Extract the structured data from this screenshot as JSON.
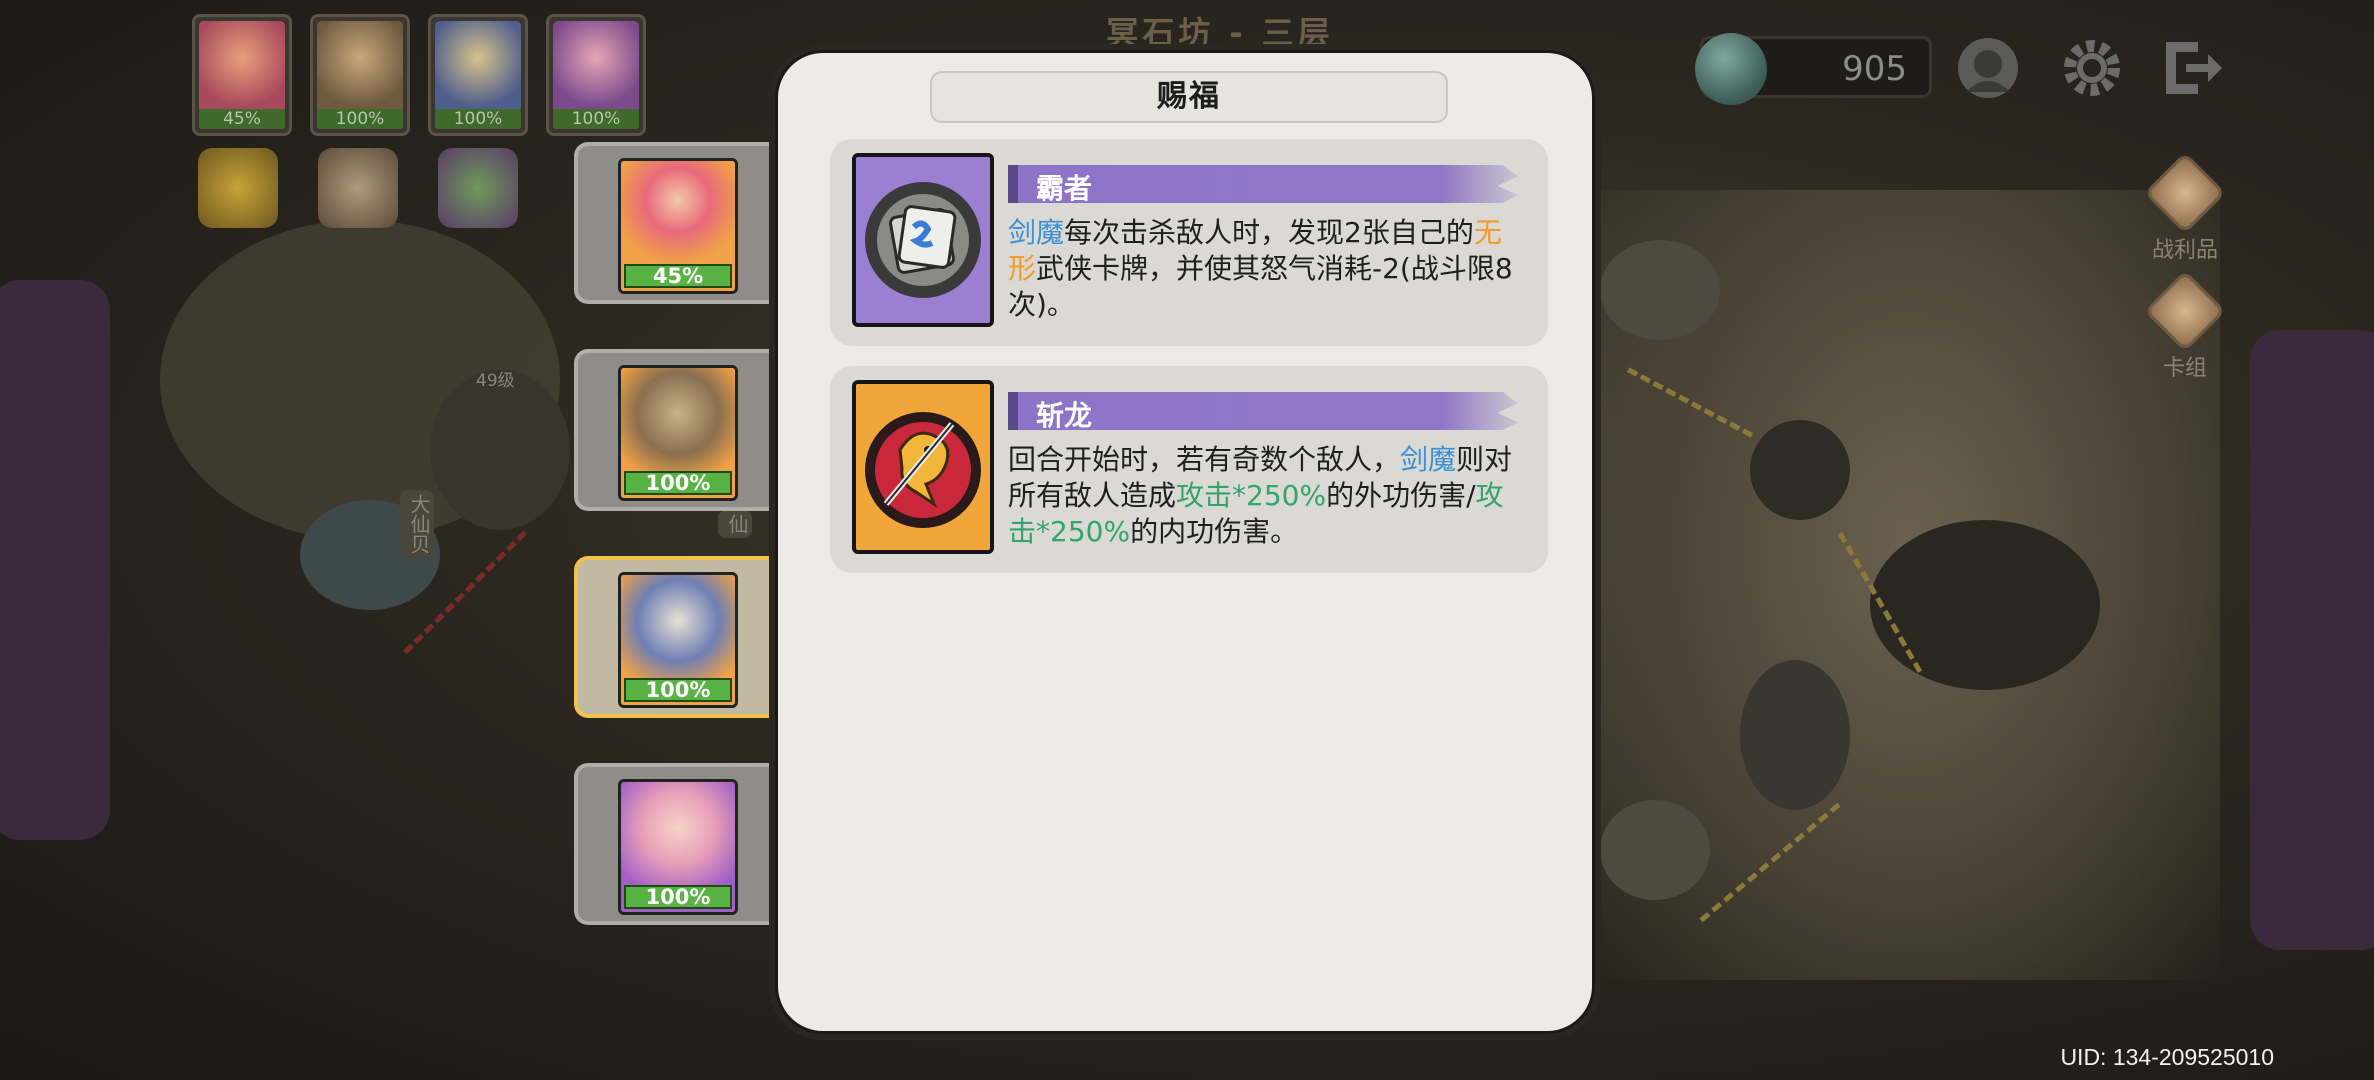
{
  "background": {
    "stage_title": "冥石坊 - 三层",
    "stage_marker_level": "49级",
    "stage_marker_name_left": "大仙贝",
    "stage_marker_name_right": "仙"
  },
  "party": [
    {
      "name": "portrait-1",
      "percent": "45%",
      "color": "#c24a64"
    },
    {
      "name": "portrait-2",
      "percent": "100%",
      "color": "#8b6f4e"
    },
    {
      "name": "portrait-3",
      "percent": "100%",
      "color": "#5d6fa4"
    },
    {
      "name": "portrait-4",
      "percent": "100%",
      "color": "#9a5aa4"
    }
  ],
  "hero_list": [
    {
      "percent": "45%",
      "bg": "#f0a246",
      "selected": false
    },
    {
      "percent": "100%",
      "bg": "#f0a246",
      "selected": false
    },
    {
      "percent": "100%",
      "bg": "#f0a246",
      "selected": true
    },
    {
      "percent": "100%",
      "bg": "#a160c4",
      "selected": false
    }
  ],
  "currency": {
    "value": "905",
    "icon": "shell-icon"
  },
  "top_buttons": [
    {
      "name": "team-icon"
    },
    {
      "name": "settings-icon"
    },
    {
      "name": "exit-icon"
    }
  ],
  "side_buttons": {
    "loot_label": "战利品",
    "deck_label": "卡组"
  },
  "uid": "UID: 134-209525010",
  "modal": {
    "title": "赐福",
    "blessings": [
      {
        "name": "霸者",
        "icon": "card-pack-icon",
        "icon_bg": "#9b7fd0",
        "desc_parts": {
          "p1": "剑魔",
          "p2": "每次击杀敌人时，发现2张自己的",
          "p3": "无形",
          "p4": "武侠卡牌，并使其怒气消耗-2(战斗限8次)。"
        }
      },
      {
        "name": "斩龙",
        "icon": "dragon-icon",
        "icon_bg": "#f0a63a",
        "desc_parts": {
          "p1": "回合开始时，若有奇数个敌人，",
          "p2": "剑魔",
          "p3": "则对所有敌人造成",
          "p4": "攻击*250%",
          "p5": "的外功伤害/",
          "p6": "攻击*250%",
          "p7": "的内功伤害。"
        }
      }
    ]
  },
  "colors": {
    "keyword_blue": "#3a90d6",
    "keyword_orange": "#f39a2c",
    "keyword_green": "#33a46c",
    "hp_green": "#58b344",
    "blessing_purple": "#8d74c9"
  }
}
